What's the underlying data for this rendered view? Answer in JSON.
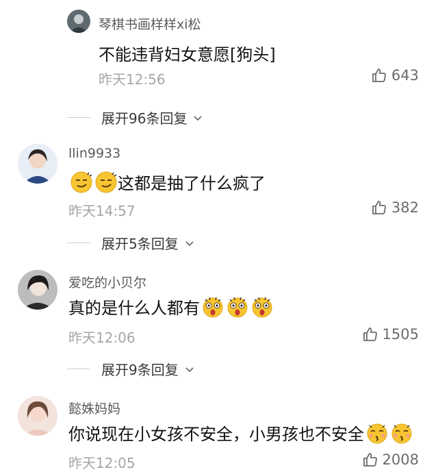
{
  "comments": [
    {
      "username": "琴棋书画样样xi松",
      "text": "不能违背妇女意愿[狗头]",
      "time": "昨天12:56",
      "likes": "643",
      "expand": "展开96条回复"
    },
    {
      "username": "llin9933",
      "text": "这都是抽了什么疯了",
      "time": "昨天14:57",
      "likes": "382",
      "expand": "展开5条回复"
    },
    {
      "username": "爱吃的小贝尔",
      "text": "真的是什么人都有",
      "time": "昨天12:06",
      "likes": "1505",
      "expand": "展开9条回复"
    },
    {
      "username": "懿姝妈妈",
      "text": "你说现在小女孩不安全，小男孩也不安全",
      "time": "昨天12:05",
      "likes": "2008"
    }
  ],
  "icons": {
    "like": "thumbs-up-icon",
    "expand": "chevron-down-icon",
    "emoji_smirk": "smirk-emoji-icon",
    "emoji_shock": "shocked-emoji-icon",
    "emoji_kiss": "kiss-emoji-icon"
  }
}
